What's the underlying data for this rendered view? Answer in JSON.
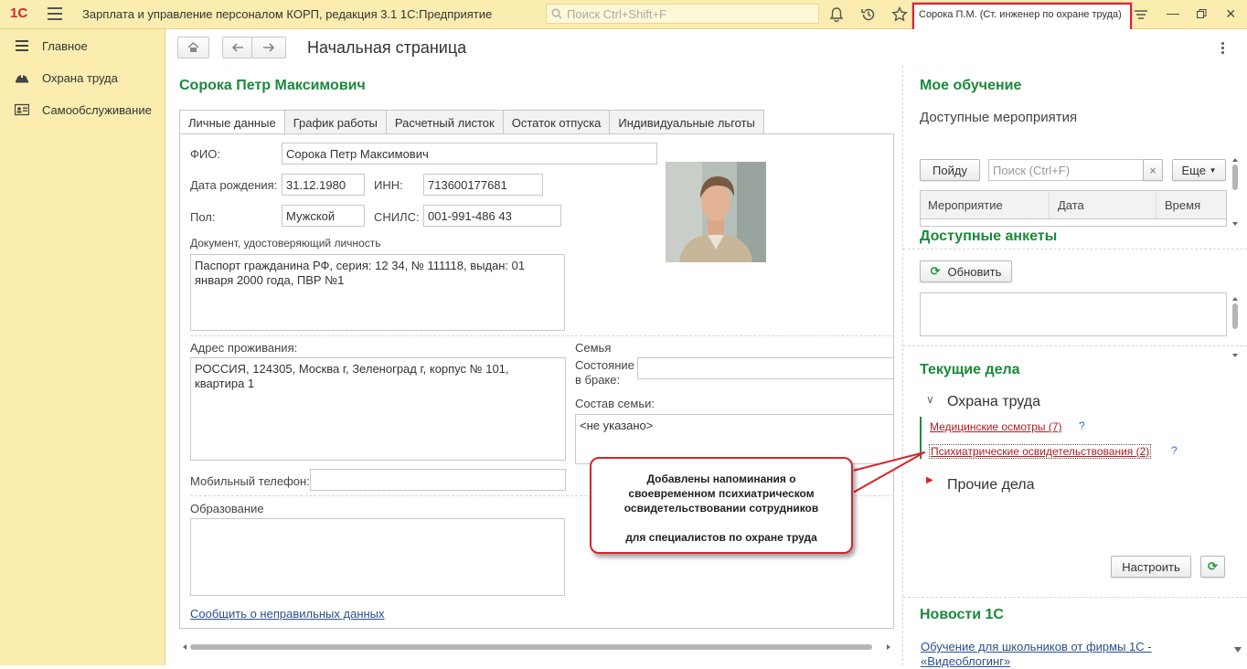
{
  "titlebar": {
    "logo": "1С",
    "app_title": "Зарплата и управление персоналом КОРП, редакция 3.1 1С:Предприятие",
    "search_placeholder": "Поиск Ctrl+Shift+F",
    "user": "Сорока П.М. (Ст. инженер по охране труда)"
  },
  "sidebar": {
    "items": [
      {
        "label": "Главное",
        "icon": "menu-lines-icon"
      },
      {
        "label": "Охрана труда",
        "icon": "helmet-icon"
      },
      {
        "label": "Самообслуживание",
        "icon": "id-card-icon"
      }
    ]
  },
  "page": {
    "title": "Начальная страница"
  },
  "employee": {
    "name": "Сорока Петр Максимович",
    "tabs": [
      "Личные данные",
      "График работы",
      "Расчетный листок",
      "Остаток отпуска",
      "Индивидуальные льготы"
    ],
    "fio_label": "ФИО:",
    "fio": "Сорока Петр Максимович",
    "birth_label": "Дата рождения:",
    "birth": "31.12.1980",
    "inn_label": "ИНН:",
    "inn": "713600177681",
    "sex_label": "Пол:",
    "sex": "Мужской",
    "snils_label": "СНИЛС:",
    "snils": "001-991-486 43",
    "doc_label": "Документ, удостоверяющий личность",
    "doc": "Паспорт гражданина РФ, серия: 12 34, № 111118, выдан: 01 января 2000 года, ПВР №1",
    "address_label": "Адрес проживания:",
    "address": "РОССИЯ, 124305, Москва г, Зеленоград г, корпус № 101, квартира 1",
    "family_label": "Семья",
    "marital_label": "Состояние в браке:",
    "family_comp_label": "Состав семьи:",
    "family_comp": "<не указано>",
    "phone_label": "Мобильный телефон:",
    "education_label": "Образование",
    "report_link": "Сообщить о неправильных данных"
  },
  "training": {
    "title": "Мое обучение",
    "subtitle": "Доступные мероприятия",
    "find_btn": "Пойду",
    "search_placeholder": "Поиск (Ctrl+F)",
    "more_btn": "Еще",
    "columns": [
      "Мероприятие",
      "Дата",
      "Время"
    ]
  },
  "surveys": {
    "title": "Доступные анкеты",
    "refresh_btn": "Обновить"
  },
  "tasks": {
    "title": "Текущие дела",
    "group1": "Охрана труда",
    "item1": "Медицинские осмотры (7)",
    "item2": "Психиатрические освидетельствования (2)",
    "help": "?",
    "group2": "Прочие дела",
    "setup_btn": "Настроить"
  },
  "news": {
    "title": "Новости 1С",
    "item1": "Обучение для школьников от фирмы 1С - «Видеоблогинг»"
  },
  "callout": {
    "line1": "Добавлены напоминания о своевременном психиатрическом освидетельствовании сотрудников",
    "line2": "для специалистов по охране труда"
  }
}
